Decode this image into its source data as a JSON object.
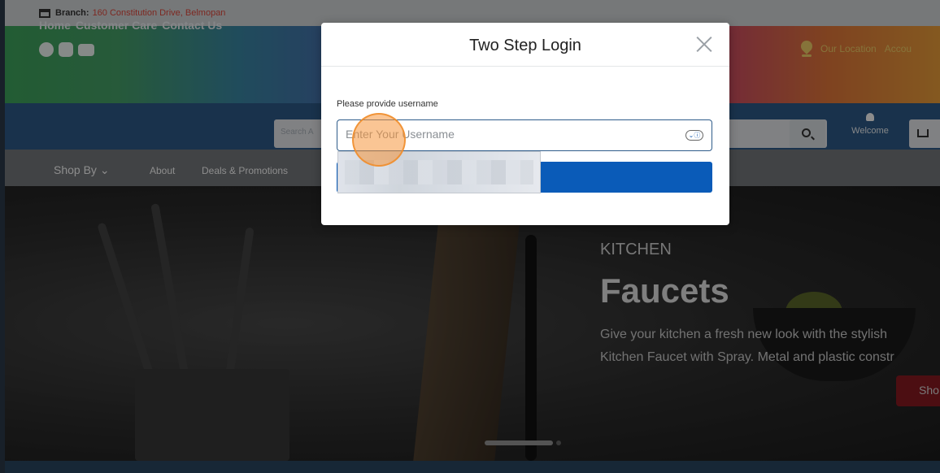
{
  "branch": {
    "label": "Branch:",
    "address": "160 Constitution Drive, Belmopan"
  },
  "header": {
    "social_icons": [
      "facebook-icon",
      "instagram-icon",
      "youtube-icon"
    ],
    "location_label": "Our Location",
    "account_label": "Accou"
  },
  "nav": {
    "links": [
      "Home",
      "Customer Care",
      "Contact Us"
    ],
    "search_placeholder": "Search A",
    "welcome_label": "Welcome"
  },
  "submenu": {
    "shop_by": "Shop By",
    "about": "About",
    "deals": "Deals & Promotions"
  },
  "hero": {
    "category": "KITCHEN",
    "title": "Faucets",
    "desc_line1": "Give your kitchen a fresh new look with the stylish",
    "desc_line2": "Kitchen Faucet with Spray. Metal and plastic constr",
    "shop_button": "Sho"
  },
  "modal": {
    "title": "Two Step Login",
    "field_label": "Please provide username",
    "username_placeholder": "Enter Your Username",
    "username_value": ""
  },
  "colors": {
    "accent": "#0a5bb8",
    "nav_bg": "#2f5c8a",
    "branch_address": "#e34a3c",
    "location": "#f4d36b"
  }
}
